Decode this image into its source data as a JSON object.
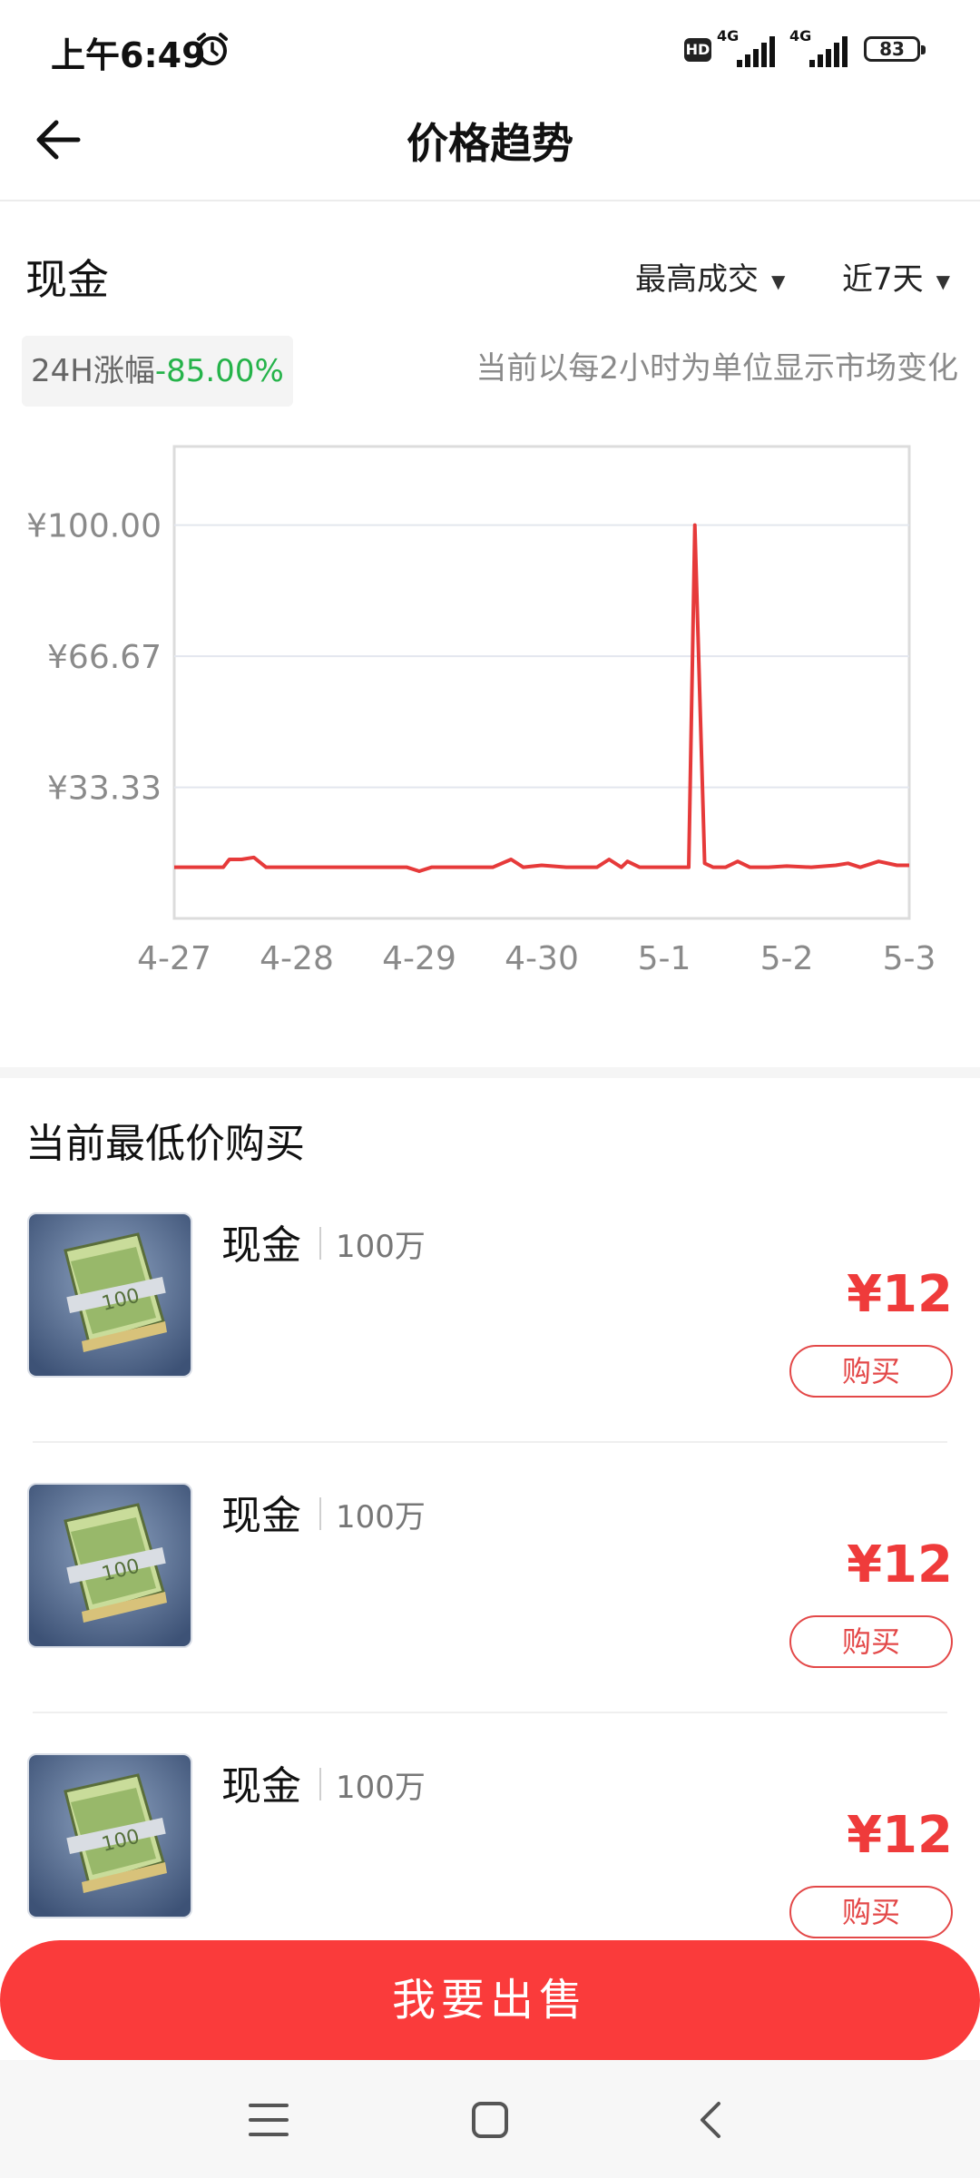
{
  "status_bar": {
    "time": "上午6:49",
    "hd": "HD",
    "network_1": "4G",
    "network_2": "4G",
    "battery": "83"
  },
  "header": {
    "title": "价格趋势"
  },
  "chart_section": {
    "item_name": "现金",
    "filter_type": "最高成交",
    "filter_range": "近7天",
    "change_label": "24H涨幅",
    "change_value": "-85.00%",
    "interval_note": "当前以每2小时为单位显示市场变化"
  },
  "chart_data": {
    "type": "line",
    "title": "",
    "xlabel": "",
    "ylabel": "",
    "x_tick_labels": [
      "4-27",
      "4-28",
      "4-29",
      "4-30",
      "5-1",
      "5-2",
      "5-3"
    ],
    "y_tick_labels": [
      "¥33.33",
      "¥66.67",
      "¥100.00"
    ],
    "y_ticks": [
      33.33,
      66.67,
      100.0
    ],
    "xlim": [
      0,
      6
    ],
    "ylim": [
      0,
      120
    ],
    "grid": true,
    "line_color": "#e63a3a",
    "series": [
      {
        "x": [
          0,
          0.2,
          0.4,
          0.45,
          0.55,
          0.65,
          0.75,
          1.0,
          1.3,
          1.6,
          1.9,
          2.0,
          2.1,
          2.3,
          2.6,
          2.75,
          2.85,
          3.0,
          3.2,
          3.45,
          3.55,
          3.65,
          3.7,
          3.8,
          4.0,
          4.15,
          4.2,
          4.25,
          4.33,
          4.4,
          4.5,
          4.6,
          4.7,
          4.85,
          5.0,
          5.2,
          5.4,
          5.5,
          5.6,
          5.75,
          5.9,
          6.0
        ],
        "y": [
          13,
          13,
          13,
          15,
          15,
          15.5,
          13,
          13,
          13,
          13,
          13,
          12,
          13,
          13,
          13,
          15,
          13,
          13.5,
          13,
          13,
          15,
          13,
          14.5,
          13,
          13,
          13,
          13,
          100,
          14,
          13,
          13,
          14.5,
          13,
          13,
          13.3,
          13,
          13.5,
          14,
          13,
          14.5,
          13.5,
          13.5
        ]
      }
    ]
  },
  "listing_section": {
    "title": "当前最低价购买",
    "items": [
      {
        "name": "现金",
        "quantity": "100万",
        "price": "¥12",
        "buy_label": "购买"
      },
      {
        "name": "现金",
        "quantity": "100万",
        "price": "¥12",
        "buy_label": "购买"
      },
      {
        "name": "现金",
        "quantity": "100万",
        "price": "¥12",
        "buy_label": "购买"
      }
    ]
  },
  "sell_button": {
    "label": "我要出售"
  },
  "nav_bar": {
    "icons": [
      "menu-icon",
      "home-icon",
      "back-icon"
    ]
  }
}
